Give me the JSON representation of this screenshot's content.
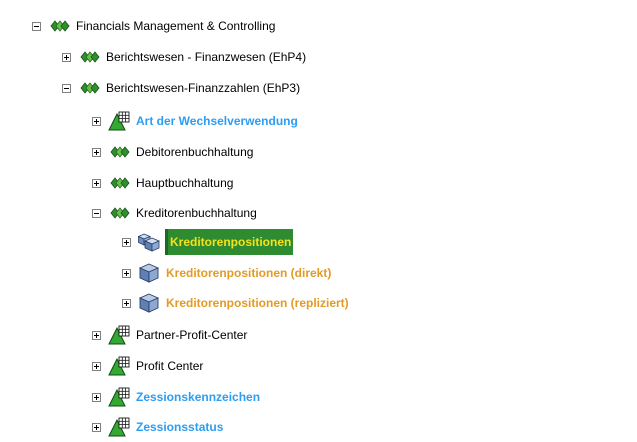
{
  "tree": {
    "root": {
      "label": "Financials Management & Controlling",
      "icon": "green-diamonds-icon",
      "state": "expanded"
    },
    "berichtswesen_finanzwesen": {
      "label": "Berichtswesen - Finanzwesen (EhP4)",
      "icon": "green-diamonds-icon",
      "state": "collapsed"
    },
    "berichtswesen_finanzzahlen": {
      "label": "Berichtswesen-Finanzzahlen (EhP3)",
      "icon": "green-diamonds-icon",
      "state": "expanded"
    },
    "art_wechselverwendung": {
      "label": "Art der Wechselverwendung",
      "icon": "infoobject-icon",
      "state": "collapsed"
    },
    "debitorenbuchhaltung": {
      "label": "Debitorenbuchhaltung",
      "icon": "green-diamonds-icon",
      "state": "collapsed"
    },
    "hauptbuchhaltung": {
      "label": "Hauptbuchhaltung",
      "icon": "green-diamonds-icon",
      "state": "collapsed"
    },
    "kreditorenbuchhaltung": {
      "label": "Kreditorenbuchhaltung",
      "icon": "green-diamonds-icon",
      "state": "expanded"
    },
    "kreditorenpositionen": {
      "label": "Kreditorenpositionen",
      "icon": "multiprovider-icon",
      "state": "collapsed",
      "selected": true
    },
    "kreditorenpositionen_direkt": {
      "label": "Kreditorenpositionen (direkt)",
      "icon": "cube-icon",
      "state": "collapsed"
    },
    "kreditorenpositionen_repliziert": {
      "label": "Kreditorenpositionen (repliziert)",
      "icon": "cube-icon",
      "state": "collapsed"
    },
    "partner_profit_center": {
      "label": "Partner-Profit-Center",
      "icon": "infoobject-icon",
      "state": "collapsed"
    },
    "profit_center": {
      "label": "Profit Center",
      "icon": "infoobject-icon",
      "state": "collapsed"
    },
    "zessionskennzeichen": {
      "label": "Zessionskennzeichen",
      "icon": "infoobject-icon",
      "state": "collapsed"
    },
    "zessionsstatus": {
      "label": "Zessionsstatus",
      "icon": "infoobject-icon",
      "state": "collapsed"
    }
  },
  "colors": {
    "link_blue": "#2d9df2",
    "orange": "#e29b26",
    "selected_bg": "#2e8b2f",
    "selected_text": "#f5e21a"
  }
}
